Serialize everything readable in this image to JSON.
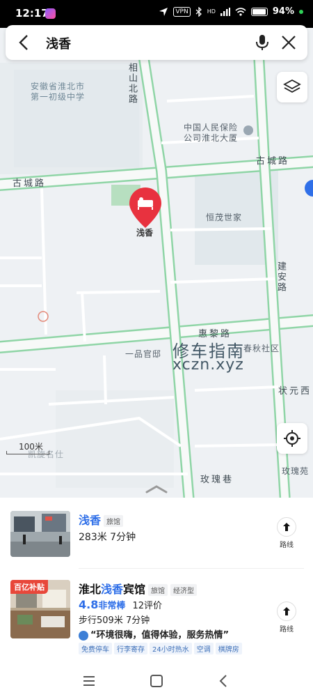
{
  "status_bar": {
    "time": "12:17",
    "vpn_label": "VPN",
    "signal_label": "HD",
    "battery": "94%"
  },
  "search": {
    "query": "浅香"
  },
  "map": {
    "labels": {
      "school": [
        "安徽省淮北市",
        "第一初级中学"
      ],
      "insurance": [
        "中国人民保险",
        "公司淮北大厦"
      ],
      "road_gucheng_west": "古城路",
      "road_gucheng_east": "古城路",
      "road_xiangshan": "相山北路",
      "hengmao": "恒茂世家",
      "road_jianan": "建安路",
      "road_huili": "惠黎路",
      "yipin": "一品官邸",
      "chunqiu": "春秋社区",
      "zhuangyuan": "状元西",
      "road_meigui": "玫瑰巷",
      "meigui_garden": "玫瑰苑",
      "kaixuan": "凯旋名仕"
    },
    "pin_label": "浅香",
    "watermark_cn": "修车指南",
    "watermark_en": "xczn.xyz",
    "scale": "100米"
  },
  "results": [
    {
      "title": "浅香",
      "title_highlight": "浅香",
      "category": "旅馆",
      "distance_line": "283米 7分钟",
      "route_label": "路线"
    },
    {
      "title_prefix": "淮北",
      "title_highlight": "浅香",
      "title_suffix": "宾馆",
      "tags": [
        "旅馆",
        "经济型"
      ],
      "thumb_badge": "百亿补贴",
      "rating": "4.8",
      "rating_text": "非常棒",
      "reviews": "12评价",
      "distance_line": "步行509米 7分钟",
      "quote": "“环境很嗨，值得体验，服务热情”",
      "features": [
        "免费停车",
        "行李寄存",
        "24小时热水",
        "空调",
        "棋牌房"
      ],
      "route_label": "路线"
    }
  ],
  "colors": {
    "accent": "#2f6fe8",
    "pin": "#e8323f",
    "road_edge": "#8fd5a6"
  }
}
